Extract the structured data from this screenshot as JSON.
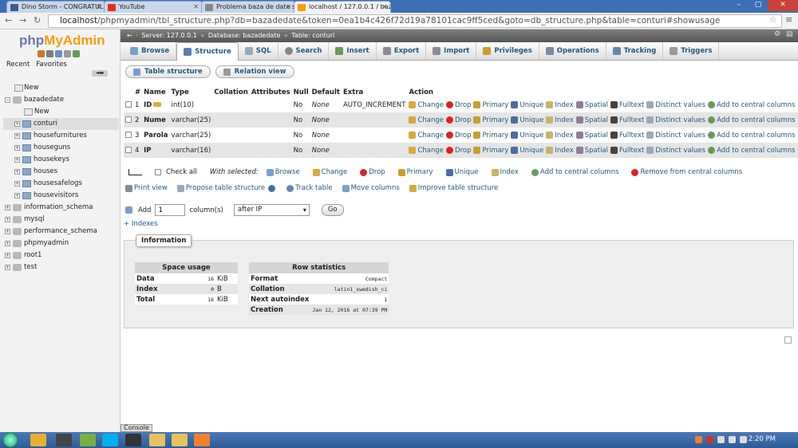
{
  "browser": {
    "tabs": [
      {
        "title": "Dino Storm - CONGRATUL",
        "icon_color": "#3b5998"
      },
      {
        "title": "YouTube",
        "icon_color": "#e52d27"
      },
      {
        "title": "Problema baza de date sa",
        "icon_color": "#888888"
      },
      {
        "title": "localhost / 127.0.0.1 / baz",
        "icon_color": "#f89c0e",
        "active": true
      }
    ],
    "url_host": "localhost",
    "url_path": "/phpmyadmin/tbl_structure.php?db=bazadedate&token=0ea1b4c426f72d19a78101cac9ff5ced&goto=db_structure.php&table=conturi#showusage"
  },
  "sidebar": {
    "logo_php": "php",
    "logo_myadmin": "MyAdmin",
    "tab_recent": "Recent",
    "tab_favorites": "Favorites",
    "new_label": "New",
    "db_open": "bazadedate",
    "db_new": "New",
    "tables": [
      "conturi",
      "housefurnitures",
      "houseguns",
      "housekeys",
      "houses",
      "housesafelogs",
      "housevisitors"
    ],
    "other_dbs": [
      "information_schema",
      "mysql",
      "performance_schema",
      "phpmyadmin",
      "root1",
      "test"
    ]
  },
  "breadcrumb": {
    "server": "Server: 127.0.0.1",
    "database": "Database: bazadedate",
    "table": "Table: conturi"
  },
  "topmenu": [
    "Browse",
    "Structure",
    "SQL",
    "Search",
    "Insert",
    "Export",
    "Import",
    "Privileges",
    "Operations",
    "Tracking",
    "Triggers"
  ],
  "subtabs": [
    "Table structure",
    "Relation view"
  ],
  "structure": {
    "headers": [
      "#",
      "Name",
      "Type",
      "Collation",
      "Attributes",
      "Null",
      "Default",
      "Extra",
      "Action"
    ],
    "rows": [
      {
        "num": "1",
        "name": "ID",
        "type": "int(10)",
        "collation": "",
        "attributes": "",
        "null": "No",
        "default": "None",
        "extra": "AUTO_INCREMENT"
      },
      {
        "num": "2",
        "name": "Nume",
        "type": "varchar(25)",
        "collation": "",
        "attributes": "",
        "null": "No",
        "default": "None",
        "extra": ""
      },
      {
        "num": "3",
        "name": "Parola",
        "type": "varchar(25)",
        "collation": "",
        "attributes": "",
        "null": "No",
        "default": "None",
        "extra": ""
      },
      {
        "num": "4",
        "name": "IP",
        "type": "varchar(16)",
        "collation": "",
        "attributes": "",
        "null": "No",
        "default": "None",
        "extra": ""
      }
    ],
    "actions": [
      "Change",
      "Drop",
      "Primary",
      "Unique",
      "Index",
      "Spatial",
      "Fulltext",
      "Distinct values",
      "Add to central columns"
    ]
  },
  "with_selected": {
    "check_all": "Check all",
    "label": "With selected:",
    "actions": [
      "Browse",
      "Change",
      "Drop",
      "Primary",
      "Unique",
      "Index",
      "Add to central columns",
      "Remove from central columns"
    ]
  },
  "tools": [
    "Print view",
    "Propose table structure",
    "Track table",
    "Move columns",
    "Improve table structure"
  ],
  "add_columns": {
    "label_add": "Add",
    "count": "1",
    "label_columns": "column(s)",
    "position": "after IP",
    "go": "Go"
  },
  "indexes_link": "+ Indexes",
  "information": {
    "legend": "Information",
    "space_usage": {
      "title": "Space usage",
      "rows": [
        {
          "label": "Data",
          "value": "16",
          "unit": "KiB"
        },
        {
          "label": "Index",
          "value": "0",
          "unit": "B"
        },
        {
          "label": "Total",
          "value": "16",
          "unit": "KiB"
        }
      ]
    },
    "row_stats": {
      "title": "Row statistics",
      "rows": [
        {
          "label": "Format",
          "value": "Compact"
        },
        {
          "label": "Collation",
          "value": "latin1_swedish_ci"
        },
        {
          "label": "Next autoindex",
          "value": "1"
        },
        {
          "label": "Creation",
          "value": "Jan 12, 2016 at 07:39 PM"
        }
      ]
    }
  },
  "console_label": "Console",
  "taskbar": {
    "clock": "2:20 PM"
  },
  "colors": {
    "link": "#235a81",
    "logo_php": "#6c78af",
    "logo_myadmin": "#f89c0e",
    "taskbar": "#2d5a96"
  }
}
